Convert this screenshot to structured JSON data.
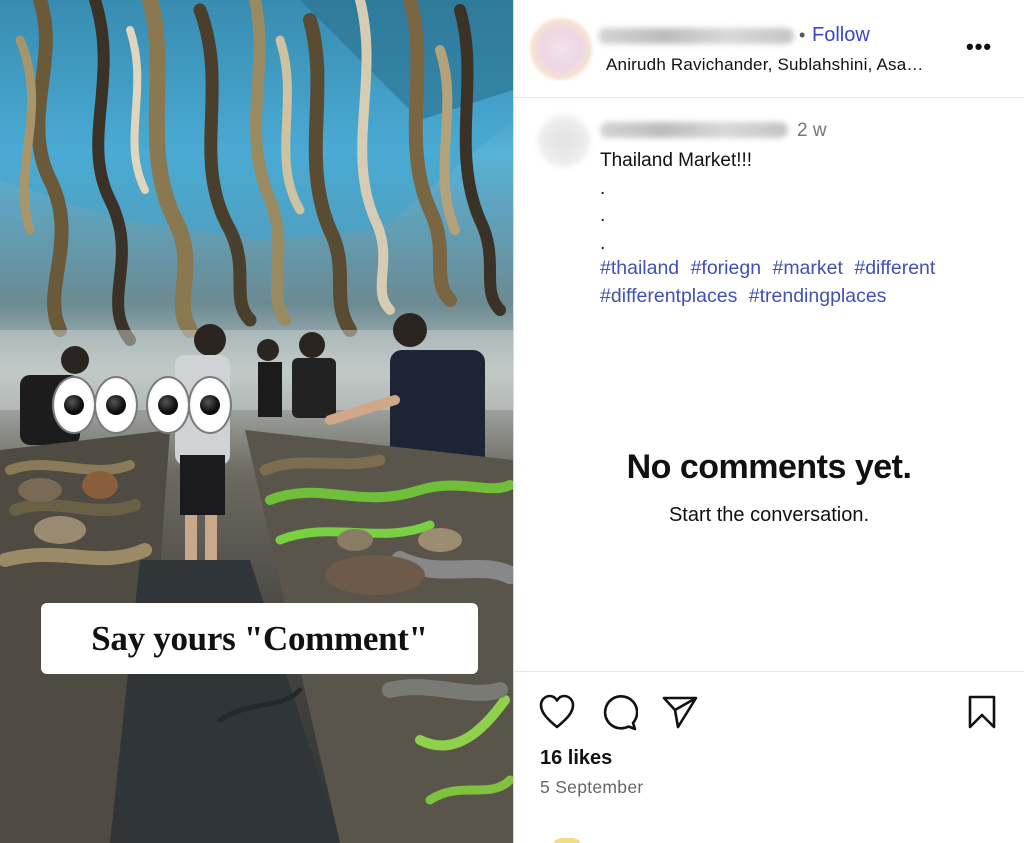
{
  "media": {
    "caption_overlay": "Say yours \"Comment\""
  },
  "post_header": {
    "follow_label": "Follow",
    "separator": "•",
    "location": "Anirudh Ravichander, Sublahshini, Asa…",
    "more_label": "•••"
  },
  "post_caption": {
    "time_ago": "2 w",
    "text": "Thailand Market!!!",
    "dots": [
      ".",
      ".",
      "."
    ],
    "hashtags": [
      "#thailand",
      "#foriegn",
      "#market",
      "#different",
      "#differentplaces",
      "#trendingplaces"
    ]
  },
  "comments": {
    "empty_title": "No comments yet.",
    "empty_subtitle": "Start the conversation."
  },
  "actions": {
    "icons": [
      "heart-icon",
      "comment-icon",
      "share-icon",
      "bookmark-icon"
    ],
    "likes": "16 likes",
    "date": "5 September"
  },
  "colors": {
    "link_blue": "#3b46c6",
    "hashtag_blue": "#3f51b5",
    "secondary_text": "#777777"
  }
}
